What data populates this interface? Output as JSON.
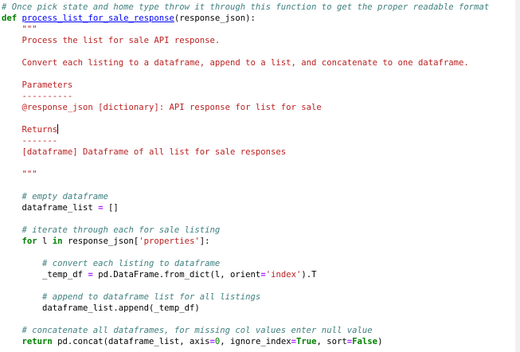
{
  "lines": [
    [
      {
        "c": "comment",
        "t": "# Once pick state and home type throw it through this function to get the proper readable format"
      }
    ],
    [
      {
        "c": "kw",
        "t": "def"
      },
      {
        "c": "",
        "t": " "
      },
      {
        "c": "fn",
        "t": "process_list_for_sale_response"
      },
      {
        "c": "",
        "t": "(response_json):"
      }
    ],
    [
      {
        "c": "doc",
        "t": "    \"\"\""
      }
    ],
    [
      {
        "c": "doc",
        "t": "    Process the list for sale API response."
      }
    ],
    [
      {
        "c": "doc",
        "t": ""
      }
    ],
    [
      {
        "c": "doc",
        "t": "    Convert each listing to a dataframe, append to a list, and concatenate to one dataframe."
      }
    ],
    [
      {
        "c": "doc",
        "t": ""
      }
    ],
    [
      {
        "c": "doc",
        "t": "    Parameters"
      }
    ],
    [
      {
        "c": "doc",
        "t": "    ----------"
      }
    ],
    [
      {
        "c": "doc",
        "t": "    @response_json [dictionary]: API response for list for sale"
      }
    ],
    [
      {
        "c": "doc",
        "t": ""
      }
    ],
    [
      {
        "c": "doc",
        "t": "    Returns"
      },
      {
        "c": "cursor",
        "t": ""
      }
    ],
    [
      {
        "c": "doc",
        "t": "    -------"
      }
    ],
    [
      {
        "c": "doc",
        "t": "    [dataframe] Dataframe of all list for sale responses"
      }
    ],
    [
      {
        "c": "doc",
        "t": ""
      }
    ],
    [
      {
        "c": "doc",
        "t": "    \"\"\""
      }
    ],
    [
      {
        "c": "",
        "t": ""
      }
    ],
    [
      {
        "c": "comment",
        "t": "    # empty dataframe"
      }
    ],
    [
      {
        "c": "",
        "t": "    dataframe_list "
      },
      {
        "c": "op",
        "t": "="
      },
      {
        "c": "",
        "t": " []"
      }
    ],
    [
      {
        "c": "",
        "t": ""
      }
    ],
    [
      {
        "c": "comment",
        "t": "    # iterate through each for sale listing"
      }
    ],
    [
      {
        "c": "",
        "t": "    "
      },
      {
        "c": "kw",
        "t": "for"
      },
      {
        "c": "",
        "t": " l "
      },
      {
        "c": "kw",
        "t": "in"
      },
      {
        "c": "",
        "t": " response_json["
      },
      {
        "c": "str",
        "t": "'properties'"
      },
      {
        "c": "",
        "t": "]:"
      }
    ],
    [
      {
        "c": "",
        "t": ""
      }
    ],
    [
      {
        "c": "comment",
        "t": "        # convert each listing to dataframe"
      }
    ],
    [
      {
        "c": "",
        "t": "        _temp_df "
      },
      {
        "c": "op",
        "t": "="
      },
      {
        "c": "",
        "t": " pd.DataFrame.from_dict(l, orient"
      },
      {
        "c": "op",
        "t": "="
      },
      {
        "c": "str",
        "t": "'index'"
      },
      {
        "c": "",
        "t": ").T"
      }
    ],
    [
      {
        "c": "",
        "t": ""
      }
    ],
    [
      {
        "c": "comment",
        "t": "        # append to dataframe list for all listings"
      }
    ],
    [
      {
        "c": "",
        "t": "        dataframe_list.append(_temp_df)"
      }
    ],
    [
      {
        "c": "",
        "t": ""
      }
    ],
    [
      {
        "c": "comment",
        "t": "    # concatenate all dataframes, for missing col values enter null value"
      }
    ],
    [
      {
        "c": "",
        "t": "    "
      },
      {
        "c": "kw",
        "t": "return"
      },
      {
        "c": "",
        "t": " pd.concat(dataframe_list, axis"
      },
      {
        "c": "op",
        "t": "="
      },
      {
        "c": "num",
        "t": "0"
      },
      {
        "c": "",
        "t": ", ignore_index"
      },
      {
        "c": "op",
        "t": "="
      },
      {
        "c": "kw",
        "t": "True"
      },
      {
        "c": "",
        "t": ", sort"
      },
      {
        "c": "op",
        "t": "="
      },
      {
        "c": "kw",
        "t": "False"
      },
      {
        "c": "",
        "t": ")"
      }
    ]
  ]
}
